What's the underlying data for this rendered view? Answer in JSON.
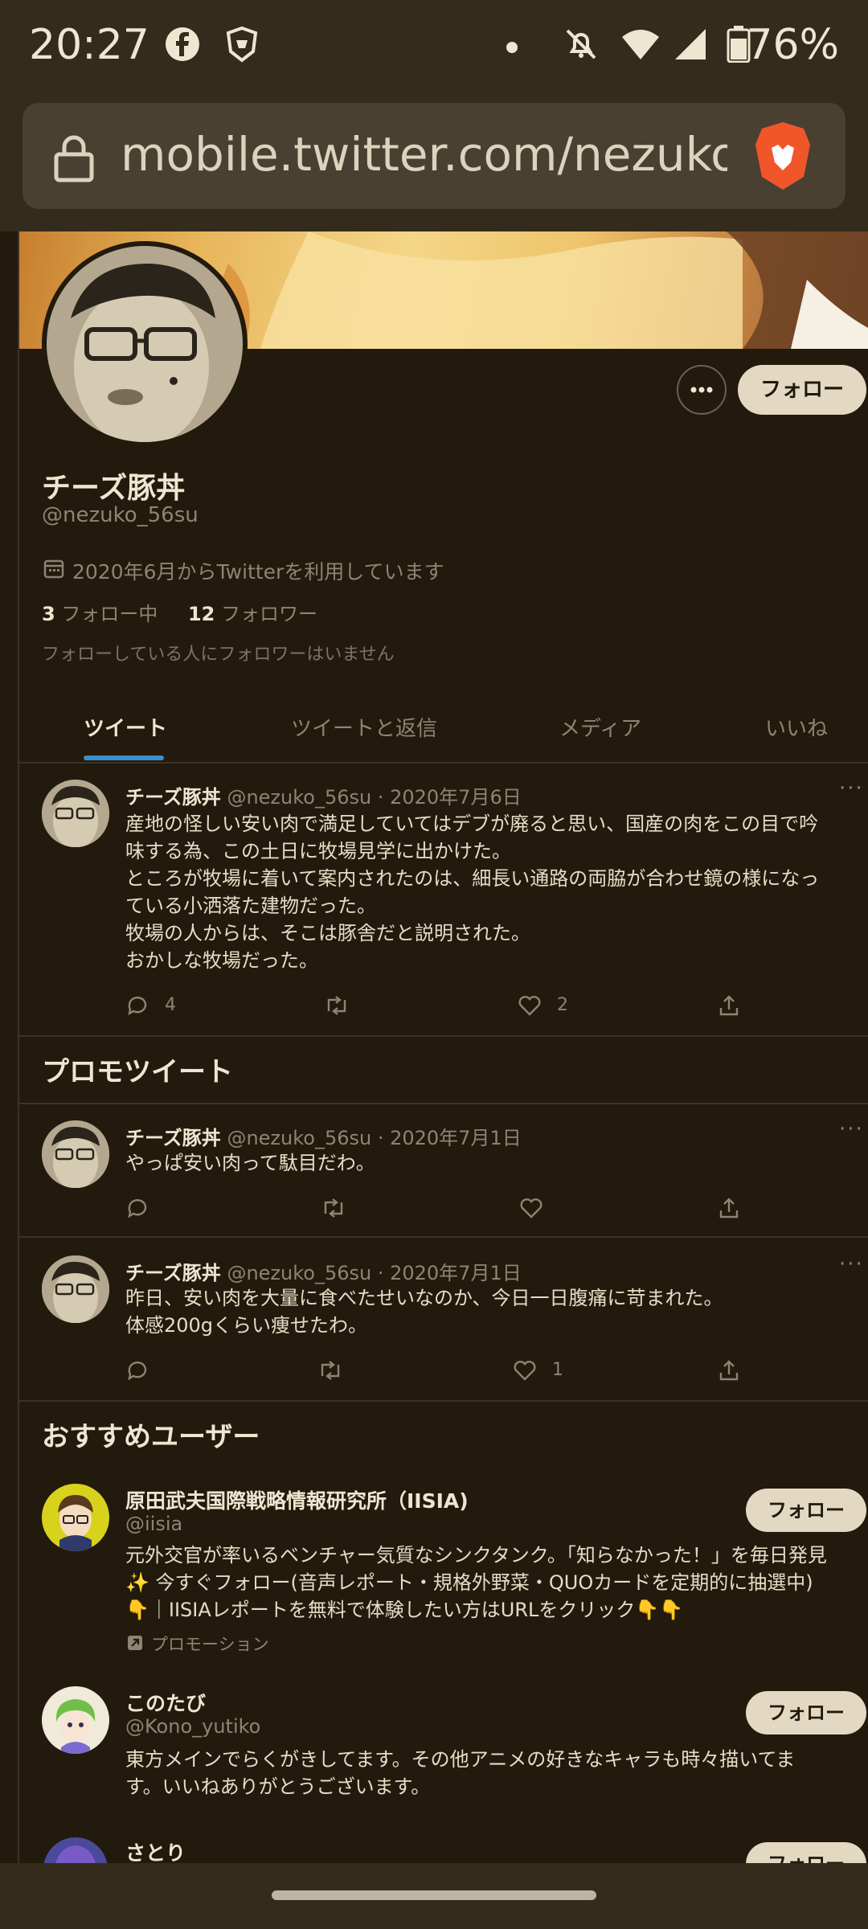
{
  "status_bar": {
    "time": "20:27",
    "battery": "76%"
  },
  "browser": {
    "url": "mobile.twitter.com/nezuko_"
  },
  "profile": {
    "name": "チーズ豚丼",
    "handle": "@nezuko_56su",
    "follow_button": "フォロー",
    "joined": "2020年6月からTwitterを利用しています",
    "following_count": "3",
    "following_label": "フォロー中",
    "followers_count": "12",
    "followers_label": "フォロワー",
    "mutual_note": "フォローしている人にフォロワーはいません"
  },
  "tabs": [
    {
      "label": "ツイート"
    },
    {
      "label": "ツイートと返信"
    },
    {
      "label": "メディア"
    },
    {
      "label": "いいね"
    }
  ],
  "tweets": [
    {
      "name": "チーズ豚丼",
      "meta": "@nezuko_56su · 2020年7月6日",
      "text": "産地の怪しい安い肉で満足していてはデブが廃ると思い、国産の肉をこの目で吟\n味する為、この土日に牧場見学に出かけた。\nところが牧場に着いて案内されたのは、細長い通路の両脇が合わせ鏡の様になっ\nている小洒落た建物だった。\n牧場の人からは、そこは豚舎だと説明された。\nおかしな牧場だった。",
      "replies": "4",
      "retweets": "",
      "likes": "2"
    },
    {
      "name": "チーズ豚丼",
      "meta": "@nezuko_56su · 2020年7月1日",
      "text": "やっぱ安い肉って駄目だわ。",
      "replies": "",
      "retweets": "",
      "likes": ""
    },
    {
      "name": "チーズ豚丼",
      "meta": "@nezuko_56su · 2020年7月1日",
      "text": "昨日、安い肉を大量に食べたせいなのか、今日一日腹痛に苛まれた。\n体感200gくらい痩せたわ。",
      "replies": "",
      "retweets": "",
      "likes": "1"
    }
  ],
  "promo_section_title": "プロモツイート",
  "recommended": {
    "title": "おすすめユーザー",
    "users": [
      {
        "name": "原田武夫国際戦略情報研究所（IISIA)",
        "handle": "@iisia",
        "bio": "元外交官が率いるベンチャー気質なシンクタンク。「知らなかった！」を毎日発見\n✨ 今すぐフォロー(音声レポート・規格外野菜・QUOカードを定期的に抽選中)\n👇｜IISIAレポートを無料で体験したい方はURLをクリック👇👇",
        "promo_label": "プロモーション",
        "follow_label": "フォロー"
      },
      {
        "name": "このたび",
        "handle": "@Kono_yutiko",
        "bio": "東方メインでらくがきしてます。その他アニメの好きなキャラも時々描いてま\nす。いいねありがとうございます。",
        "follow_label": "フォロー"
      },
      {
        "name": "さとり",
        "follow_label": "フォロー"
      }
    ]
  }
}
